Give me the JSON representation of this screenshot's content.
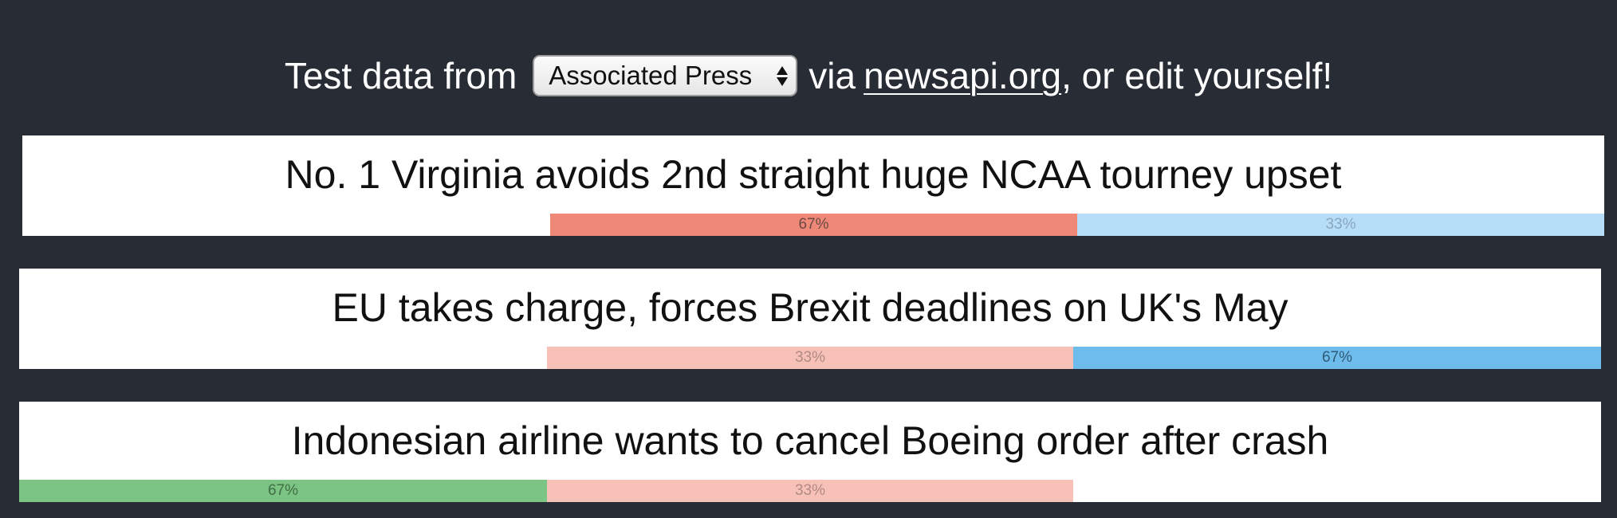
{
  "header": {
    "prefix": "Test data from",
    "source_selected": "Associated Press",
    "via": "via",
    "link_text": "newsapi.org",
    "suffix": ", or edit yourself!"
  },
  "articles": [
    {
      "title": "No. 1 Virginia avoids 2nd straight huge NCAA tourney upset",
      "bars": [
        {
          "label": "67%",
          "value": 67,
          "color": "#f08878",
          "text_color": "#6b4a44"
        },
        {
          "label": "33%",
          "value": 33,
          "color": "#b6def8",
          "text_color": "#8aa6bd"
        }
      ]
    },
    {
      "title": "EU takes charge, forces Brexit deadlines on UK's May",
      "bars": [
        {
          "label": "33%",
          "value": 33,
          "color": "#f8c1b8",
          "text_color": "#b08a84"
        },
        {
          "label": "67%",
          "value": 67,
          "color": "#6ebcec",
          "text_color": "#2f5a78"
        }
      ]
    },
    {
      "title": "Indonesian airline wants to cancel Boeing order after crash",
      "bars": [
        {
          "label": "67%",
          "value": 67,
          "color": "#7cc484",
          "text_color": "#3f6e44"
        },
        {
          "label": "33%",
          "value": 33,
          "color": "#f8c1b8",
          "text_color": "#b08a84"
        }
      ]
    }
  ]
}
